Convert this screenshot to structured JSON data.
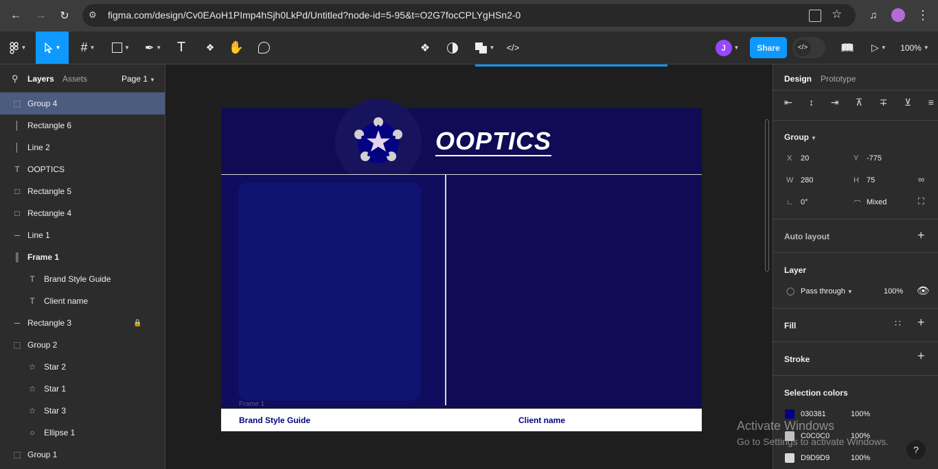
{
  "browser": {
    "url": "figma.com/design/Cv0EAoH1PImp4hSjh0LkPd/Untitled?node-id=5-95&t=O2G7focCPLYgHSn2-0"
  },
  "toolbar": {
    "avatar_initial": "J",
    "share_label": "Share",
    "zoom": "100%"
  },
  "left_panel": {
    "tabs": [
      "Layers",
      "Assets"
    ],
    "page_label": "Page 1",
    "layers": [
      {
        "name": "Group 4",
        "icon": "group-icon",
        "indent": 0,
        "selected": true
      },
      {
        "name": "Rectangle 6",
        "icon": "line-vertical-icon",
        "indent": 0
      },
      {
        "name": "Line 2",
        "icon": "line-vertical-icon",
        "indent": 0
      },
      {
        "name": "OOPTICS",
        "icon": "text-icon",
        "indent": 0
      },
      {
        "name": "Rectangle 5",
        "icon": "rectangle-icon",
        "indent": 0
      },
      {
        "name": "Rectangle 4",
        "icon": "rectangle-icon",
        "indent": 0
      },
      {
        "name": "Line 1",
        "icon": "line-horizontal-icon",
        "indent": 0
      },
      {
        "name": "Frame 1",
        "icon": "frame-icon",
        "indent": 0,
        "bold": true
      },
      {
        "name": "Brand Style Guide",
        "icon": "text-icon",
        "indent": 1
      },
      {
        "name": "Client name",
        "icon": "text-icon",
        "indent": 1
      },
      {
        "name": "Rectangle 3",
        "icon": "line-horizontal-icon",
        "indent": 0,
        "locked": true
      },
      {
        "name": "Group 2",
        "icon": "group-icon",
        "indent": 0
      },
      {
        "name": "Star 2",
        "icon": "star-icon",
        "indent": 1
      },
      {
        "name": "Star 1",
        "icon": "star-icon",
        "indent": 1
      },
      {
        "name": "Star 3",
        "icon": "star-icon",
        "indent": 1
      },
      {
        "name": "Ellipse 1",
        "icon": "ellipse-icon",
        "indent": 1
      },
      {
        "name": "Group 1",
        "icon": "group-icon",
        "indent": 0
      }
    ]
  },
  "canvas": {
    "logo_text": "OOPTICS",
    "frame_label": "Frame 1",
    "footer_left": "Brand Style Guide",
    "footer_right": "Client name",
    "colors": {
      "navy": "#0f0c55",
      "card": "#0f1470",
      "star": "#030381",
      "footer_text": "#030381"
    }
  },
  "right_panel": {
    "tabs": [
      "Design",
      "Prototype"
    ],
    "group_label": "Group",
    "x_label": "X",
    "x_value": "20",
    "y_label": "Y",
    "y_value": "-775",
    "w_label": "W",
    "w_value": "280",
    "h_label": "H",
    "h_value": "75",
    "rotation": "0°",
    "radius": "Mixed",
    "auto_layout": "Auto layout",
    "layer_title": "Layer",
    "blend_mode": "Pass through",
    "opacity": "100%",
    "fill_title": "Fill",
    "stroke_title": "Stroke",
    "selection_colors_title": "Selection colors",
    "selection_colors": [
      {
        "hex": "030381",
        "opacity": "100%",
        "color": "#030381"
      },
      {
        "hex": "C0C0C0",
        "opacity": "100%",
        "color": "#c0c0c0"
      },
      {
        "hex": "D9D9D9",
        "opacity": "100%",
        "color": "#d9d9d9"
      }
    ]
  },
  "watermark": {
    "title": "Activate Windows",
    "subtitle": "Go to Settings to activate Windows."
  },
  "help_label": "?"
}
